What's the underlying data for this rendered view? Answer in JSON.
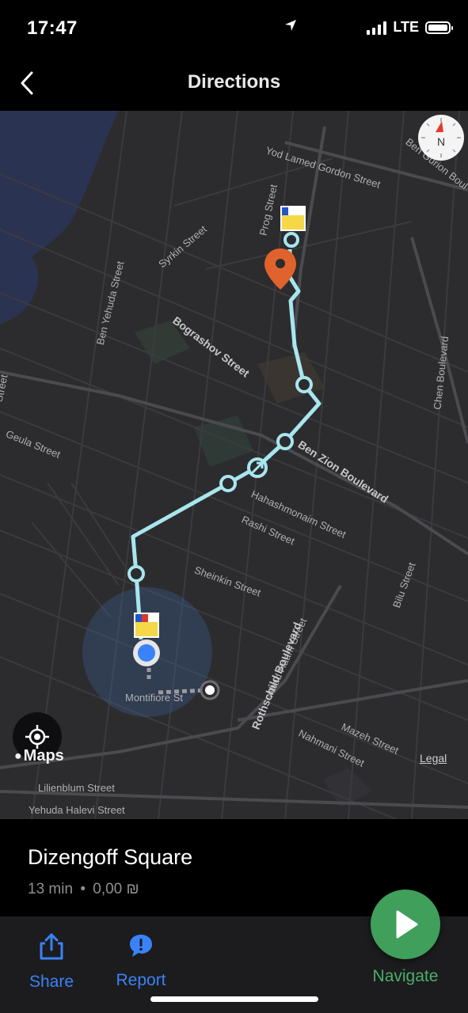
{
  "status_bar": {
    "time": "17:47",
    "network": "LTE"
  },
  "nav": {
    "title": "Directions"
  },
  "map": {
    "streets": [
      "Yod Lamed Gordon Street",
      "Ben Gurion Boul",
      "Prog Street",
      "Syrkin Street",
      "Ben Yehuda Street",
      "Bograshov Street",
      "Chen Boulevard",
      "Street",
      "Geula Street",
      "Ben Zion Boulevard",
      "Hahashmonaim Street",
      "Rashi Street",
      "Bilu Street",
      "Sheinkin Street",
      "Ahad Haam Street",
      "Rothschild Boulevard",
      "Montifiore St",
      "Mazeh Street",
      "Nahmani Street",
      "Lilienblum Street",
      "Yehuda Halevi Street"
    ],
    "compass_letter": "N",
    "brand": "Maps",
    "legal": "Legal",
    "route_color": "#a8e6ef",
    "pin_color": "#e0622d"
  },
  "destination": {
    "title": "Dizengoff Square",
    "duration": "13 min",
    "separator": "•",
    "fare": "0,00 ₪"
  },
  "actions": {
    "share": "Share",
    "report": "Report",
    "navigate": "Navigate"
  }
}
